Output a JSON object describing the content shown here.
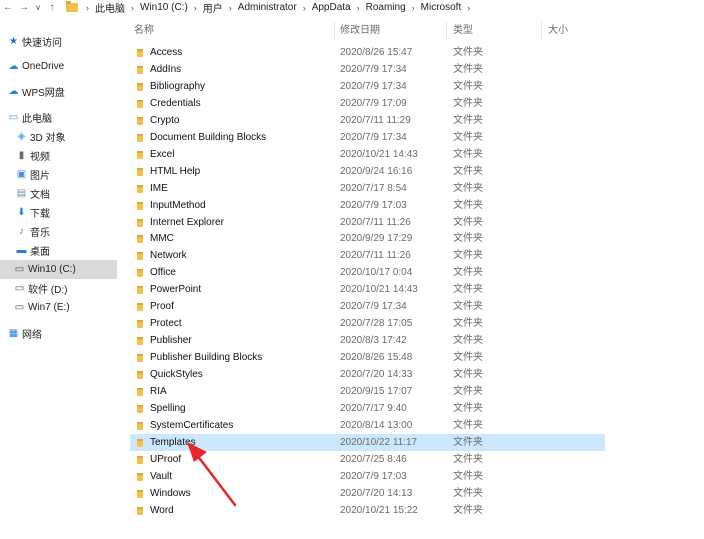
{
  "address_bar": {
    "back_icon": "back-arrow-icon",
    "forward_icon": "forward-arrow-icon",
    "dropdown_icon": "chevron-down-icon",
    "up_icon": "up-arrow-icon",
    "breadcrumbs": [
      "此电脑",
      "Win10 (C:)",
      "用户",
      "Administrator",
      "AppData",
      "Roaming",
      "Microsoft"
    ]
  },
  "sidebar": {
    "items": [
      {
        "label": "快速访问",
        "icon": "star-icon"
      },
      {
        "label": "OneDrive",
        "icon": "cloud-icon"
      },
      {
        "label": "WPS网盘",
        "icon": "cloud-icon"
      },
      {
        "label": "此电脑",
        "icon": "computer-icon"
      },
      {
        "label": "3D 对象",
        "icon": "cube-icon"
      },
      {
        "label": "视频",
        "icon": "video-icon"
      },
      {
        "label": "图片",
        "icon": "picture-icon"
      },
      {
        "label": "文档",
        "icon": "document-icon"
      },
      {
        "label": "下载",
        "icon": "download-icon"
      },
      {
        "label": "音乐",
        "icon": "music-icon"
      },
      {
        "label": "桌面",
        "icon": "desktop-icon"
      },
      {
        "label": "Win10 (C:)",
        "icon": "drive-icon",
        "selected": true
      },
      {
        "label": "软件 (D:)",
        "icon": "drive-icon"
      },
      {
        "label": "Win7 (E:)",
        "icon": "drive-icon"
      },
      {
        "label": "网络",
        "icon": "network-icon"
      }
    ]
  },
  "columns": {
    "name": "名称",
    "date": "修改日期",
    "type": "类型",
    "size": "大小"
  },
  "files": [
    {
      "name": "Access",
      "date": "2020/8/26 15:47",
      "type": "文件夹"
    },
    {
      "name": "AddIns",
      "date": "2020/7/9 17:34",
      "type": "文件夹"
    },
    {
      "name": "Bibliography",
      "date": "2020/7/9 17:34",
      "type": "文件夹"
    },
    {
      "name": "Credentials",
      "date": "2020/7/9 17:09",
      "type": "文件夹"
    },
    {
      "name": "Crypto",
      "date": "2020/7/11 11:29",
      "type": "文件夹"
    },
    {
      "name": "Document Building Blocks",
      "date": "2020/7/9 17:34",
      "type": "文件夹"
    },
    {
      "name": "Excel",
      "date": "2020/10/21 14:43",
      "type": "文件夹"
    },
    {
      "name": "HTML Help",
      "date": "2020/9/24 16:16",
      "type": "文件夹"
    },
    {
      "name": "IME",
      "date": "2020/7/17 8:54",
      "type": "文件夹"
    },
    {
      "name": "InputMethod",
      "date": "2020/7/9 17:03",
      "type": "文件夹"
    },
    {
      "name": "Internet Explorer",
      "date": "2020/7/11 11:26",
      "type": "文件夹"
    },
    {
      "name": "MMC",
      "date": "2020/9/29 17:29",
      "type": "文件夹"
    },
    {
      "name": "Network",
      "date": "2020/7/11 11:26",
      "type": "文件夹"
    },
    {
      "name": "Office",
      "date": "2020/10/17 0:04",
      "type": "文件夹"
    },
    {
      "name": "PowerPoint",
      "date": "2020/10/21 14:43",
      "type": "文件夹"
    },
    {
      "name": "Proof",
      "date": "2020/7/9 17:34",
      "type": "文件夹"
    },
    {
      "name": "Protect",
      "date": "2020/7/28 17:05",
      "type": "文件夹"
    },
    {
      "name": "Publisher",
      "date": "2020/8/3 17:42",
      "type": "文件夹"
    },
    {
      "name": "Publisher Building Blocks",
      "date": "2020/8/26 15:48",
      "type": "文件夹"
    },
    {
      "name": "QuickStyles",
      "date": "2020/7/20 14:33",
      "type": "文件夹"
    },
    {
      "name": "RIA",
      "date": "2020/9/15 17:07",
      "type": "文件夹"
    },
    {
      "name": "Spelling",
      "date": "2020/7/17 9:40",
      "type": "文件夹"
    },
    {
      "name": "SystemCertificates",
      "date": "2020/8/14 13:00",
      "type": "文件夹"
    },
    {
      "name": "Templates",
      "date": "2020/10/22 11:17",
      "type": "文件夹",
      "selected": true
    },
    {
      "name": "UProof",
      "date": "2020/7/25 8:46",
      "type": "文件夹"
    },
    {
      "name": "Vault",
      "date": "2020/7/9 17:03",
      "type": "文件夹"
    },
    {
      "name": "Windows",
      "date": "2020/7/20 14:13",
      "type": "文件夹"
    },
    {
      "name": "Word",
      "date": "2020/10/21 15:22",
      "type": "文件夹"
    }
  ],
  "colors": {
    "selection": "#cce8ff",
    "sidebar_selection": "#d9d9d9",
    "folder": "#f3c14b",
    "annotation_arrow": "#e8262b"
  }
}
